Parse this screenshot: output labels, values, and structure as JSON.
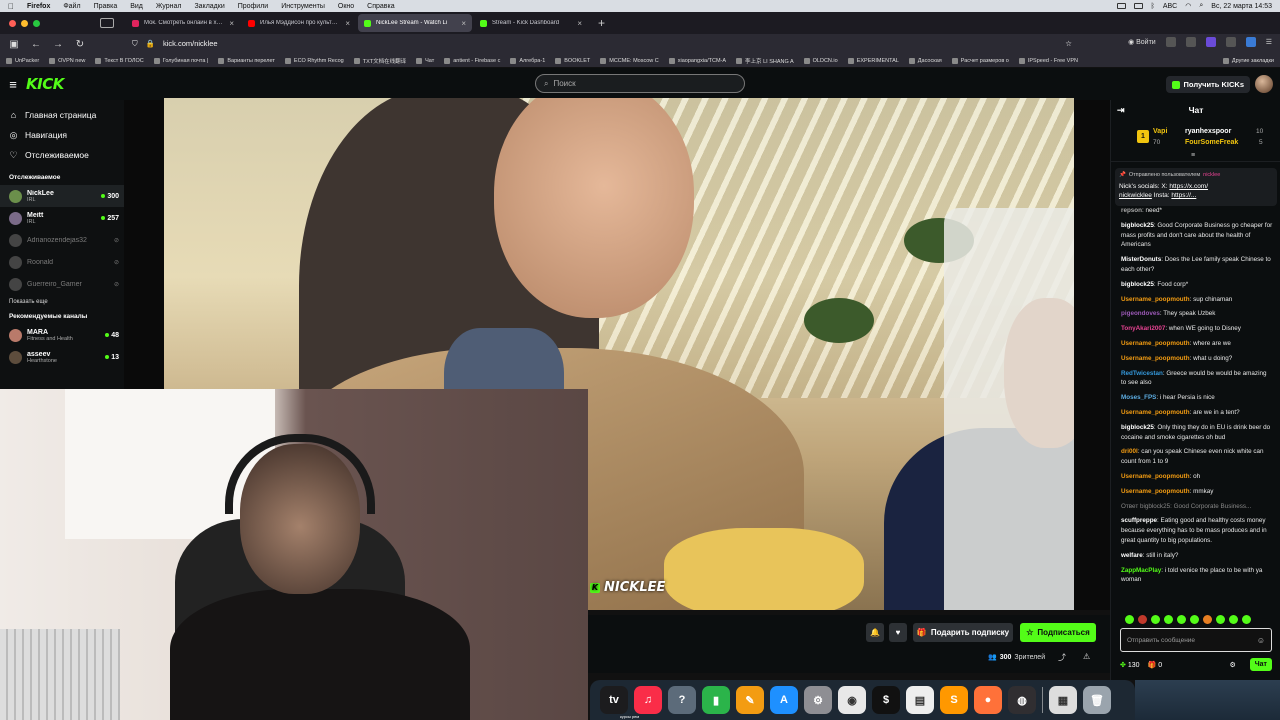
{
  "menubar": {
    "app": "Firefox",
    "items": [
      "Файл",
      "Правка",
      "Вид",
      "Журнал",
      "Закладки",
      "Профили",
      "Инструменты",
      "Окно",
      "Справка"
    ],
    "keyboard": "ABC",
    "datetime": "Вс, 22 марта 14:53"
  },
  "tabs": [
    {
      "title": "Мок. Смотреть онлайн в хоро",
      "color": "#e0245e"
    },
    {
      "title": "Илья Мэддисон про культуру",
      "color": "#ff0000"
    },
    {
      "title": "NickLee Stream - Watch Li",
      "color": "#53fc18"
    },
    {
      "title": "Stream - Kick Dashboard",
      "color": "#53fc18"
    }
  ],
  "url": "kick.com/nicklee",
  "nav_right": {
    "login": "Войти"
  },
  "bookmarks": [
    "UnPacker",
    "OVPN new",
    "Текст В ГОЛОС",
    "Голубиная почта |",
    "Варианты перелет",
    "ECO Rhythm Recog",
    "TXT文档在线翻译",
    "Чат",
    "antient - Firebase c",
    "Алгебра-1",
    "BOOKLET",
    "MCCME: Moscow C",
    "xiaopangxia/TCM-A",
    "李上京 LI SHANG A",
    "OLDCN.io",
    "EXPERIMENTAL",
    "Дасоская",
    "Расчет размеров о",
    "IPSpeed - Free VPN"
  ],
  "bookmarks_other": "Другие закладки",
  "header": {
    "logo": "KICK",
    "search_placeholder": "Поиск",
    "get_kicks": "Получить KICKs"
  },
  "sidebar": {
    "nav": [
      {
        "icon": "home-icon",
        "label": "Главная страница",
        "glyph": "⌂"
      },
      {
        "icon": "compass-icon",
        "label": "Навигация",
        "glyph": "◎"
      },
      {
        "icon": "heart-icon",
        "label": "Отслеживаемое",
        "glyph": "♡"
      }
    ],
    "following_title": "Отслеживаемое",
    "following": [
      {
        "name": "NickLee",
        "category": "IRL",
        "viewers": "300",
        "live": true,
        "avatar": "#6b8f4b"
      },
      {
        "name": "Meitt",
        "category": "IRL",
        "viewers": "257",
        "live": true,
        "avatar": "#7a6a88"
      },
      {
        "name": "Adrianozendejas32",
        "category": "",
        "viewers": "",
        "live": false
      },
      {
        "name": "Roonald",
        "category": "",
        "viewers": "",
        "live": false
      },
      {
        "name": "Guerreiro_Gamer",
        "category": "",
        "viewers": "",
        "live": false
      }
    ],
    "show_more": "Показать еще",
    "recommended_title": "Рекомендуемые каналы",
    "recommended": [
      {
        "name": "MARA",
        "category": "Fitness and Health",
        "viewers": "48",
        "avatar": "#b97a6a"
      },
      {
        "name": "asseev",
        "category": "Hearthstone",
        "viewers": "13",
        "avatar": "#5d4d3d"
      }
    ]
  },
  "video": {
    "watermark": "NICKLEE"
  },
  "under_video": {
    "gift": "Подарить подписку",
    "subscribe": "Подписаться",
    "viewers_count": "300",
    "viewers_label": "Зрителей"
  },
  "chat": {
    "title": "Чат",
    "gifters": [
      {
        "rank": "1",
        "name": "Vapi",
        "count": "70",
        "color": "#f1c40f"
      },
      {
        "name": "ryanhexspoor",
        "count": "10",
        "color": "#ffffff"
      },
      {
        "name": "FourSomeFreak",
        "count": "5",
        "color": "#f1c40f"
      }
    ],
    "pinned_by": "Отправлено пользователем",
    "pinned_user": "nicklee",
    "pinned_text": "Nick's socials: X:",
    "pinned_link1": "https://x.com/",
    "pinned_link2": "nickwicklee",
    "pinned_insta": " Insta: ",
    "pinned_link3": "https://...",
    "messages": [
      {
        "user": "repson",
        "color": "#aaaaaa",
        "text": ": need*"
      },
      {
        "user": "bigblock25",
        "color": "#ffffff",
        "text": ": Good Corporate Business go cheaper for mass profits and don't care about the health of Americans"
      },
      {
        "user": "MisterDonuts",
        "color": "#ffffff",
        "text": ": Does the Lee family speak Chinese to each other?"
      },
      {
        "user": "bigblock25",
        "color": "#ffffff",
        "text": ": Food corp*"
      },
      {
        "user": "Username_poopmouth",
        "color": "#f39c12",
        "text": ": sup chinaman"
      },
      {
        "user": "pigeondoves",
        "color": "#9b59b6",
        "text": ": They speak Uzbek"
      },
      {
        "user": "TonyAkari2007",
        "color": "#e84393",
        "text": ": when WE going to Disney"
      },
      {
        "user": "Username_poopmouth",
        "color": "#f39c12",
        "text": ": where are we"
      },
      {
        "user": "Username_poopmouth",
        "color": "#f39c12",
        "text": ": what u doing?"
      },
      {
        "user": "RedTwicestan",
        "color": "#3498db",
        "text": ": Greece would be would be amazing to see also"
      },
      {
        "user": "Moses_FPS",
        "color": "#5dade2",
        "text": ": i hear Persia is nice"
      },
      {
        "user": "Username_poopmouth",
        "color": "#f39c12",
        "text": ": are we in a tent?"
      },
      {
        "user": "bigblock25",
        "color": "#ffffff",
        "text": ": Only thing they do in EU is drink beer do cocaine and smoke cigarettes oh bud"
      },
      {
        "user": "dri00l",
        "color": "#f39c12",
        "text": ": can you speak Chinese even nick white can count from 1 to 9"
      },
      {
        "user": "Username_poopmouth",
        "color": "#f39c12",
        "text": ": oh"
      },
      {
        "user": "Username_poopmouth",
        "color": "#f39c12",
        "text": ": mmkay"
      },
      {
        "user": "",
        "color": "#888888",
        "text": "Ответ bigblock25: Good Corporate Business..."
      },
      {
        "user": "scuffpreppe",
        "color": "#ffffff",
        "text": ": Eating good and healthy costs money because everything has to be mass produces and in great quantity to big populations."
      },
      {
        "user": "welfare",
        "color": "#ffffff",
        "text": ": still in italy?"
      },
      {
        "user": "ZappMacPlay",
        "color": "#53fc18",
        "text": ": i told venice the place to be with ya woman"
      }
    ],
    "input_placeholder": "Отправить сообщение",
    "kicks_balance": "130",
    "gift_balance": "0",
    "send": "Чат"
  },
  "dock": {
    "apps": [
      {
        "name": "tv",
        "label": "tv",
        "color": "#1c1c1e"
      },
      {
        "name": "music",
        "label": "♫",
        "color": "#fa2d48"
      },
      {
        "name": "help",
        "label": "?",
        "color": "#5c6b7a"
      },
      {
        "name": "numbers",
        "label": "▮",
        "color": "#2bb44a"
      },
      {
        "name": "pages",
        "label": "✎",
        "color": "#f39c12"
      },
      {
        "name": "appstore",
        "label": "A",
        "color": "#1e90ff"
      },
      {
        "name": "settings",
        "label": "⚙",
        "color": "#8e8e93"
      },
      {
        "name": "chrome",
        "label": "◉",
        "color": "#e8e8e8"
      },
      {
        "name": "terminal",
        "label": "$",
        "color": "#111111"
      },
      {
        "name": "textedit",
        "label": "▤",
        "color": "#eeeeee"
      },
      {
        "name": "sublime",
        "label": "S",
        "color": "#ff9800"
      },
      {
        "name": "firefox",
        "label": "●",
        "color": "#ff7139"
      },
      {
        "name": "obs",
        "label": "◍",
        "color": "#302e31"
      },
      {
        "name": "pdf",
        "label": "▦",
        "color": "#dddddd"
      },
      {
        "name": "trash",
        "label": "🗑",
        "color": "#9aa4ad"
      }
    ],
    "label": "курсы рем"
  }
}
